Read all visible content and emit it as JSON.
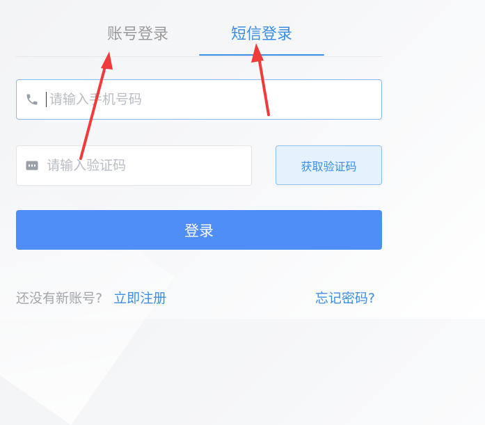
{
  "tabs": {
    "account_login": "账号登录",
    "sms_login": "短信登录",
    "active": "sms_login"
  },
  "phone": {
    "icon": "phone-icon",
    "placeholder": "请输入手机号码",
    "value": ""
  },
  "code": {
    "icon": "message-icon",
    "placeholder": "请输入验证码",
    "value": ""
  },
  "get_code_button": {
    "label": "获取验证码"
  },
  "login_button": {
    "label": "登录"
  },
  "footer": {
    "no_account_text": "还没有新账号?",
    "register_link": "立即注册",
    "forgot_password_link": "忘记密码?"
  },
  "annotations": {
    "arrow_color": "#f03b3b"
  },
  "colors": {
    "accent": "#3a8ee6",
    "login_button": "#4f8ef7",
    "muted_text": "#9a9a9a"
  }
}
